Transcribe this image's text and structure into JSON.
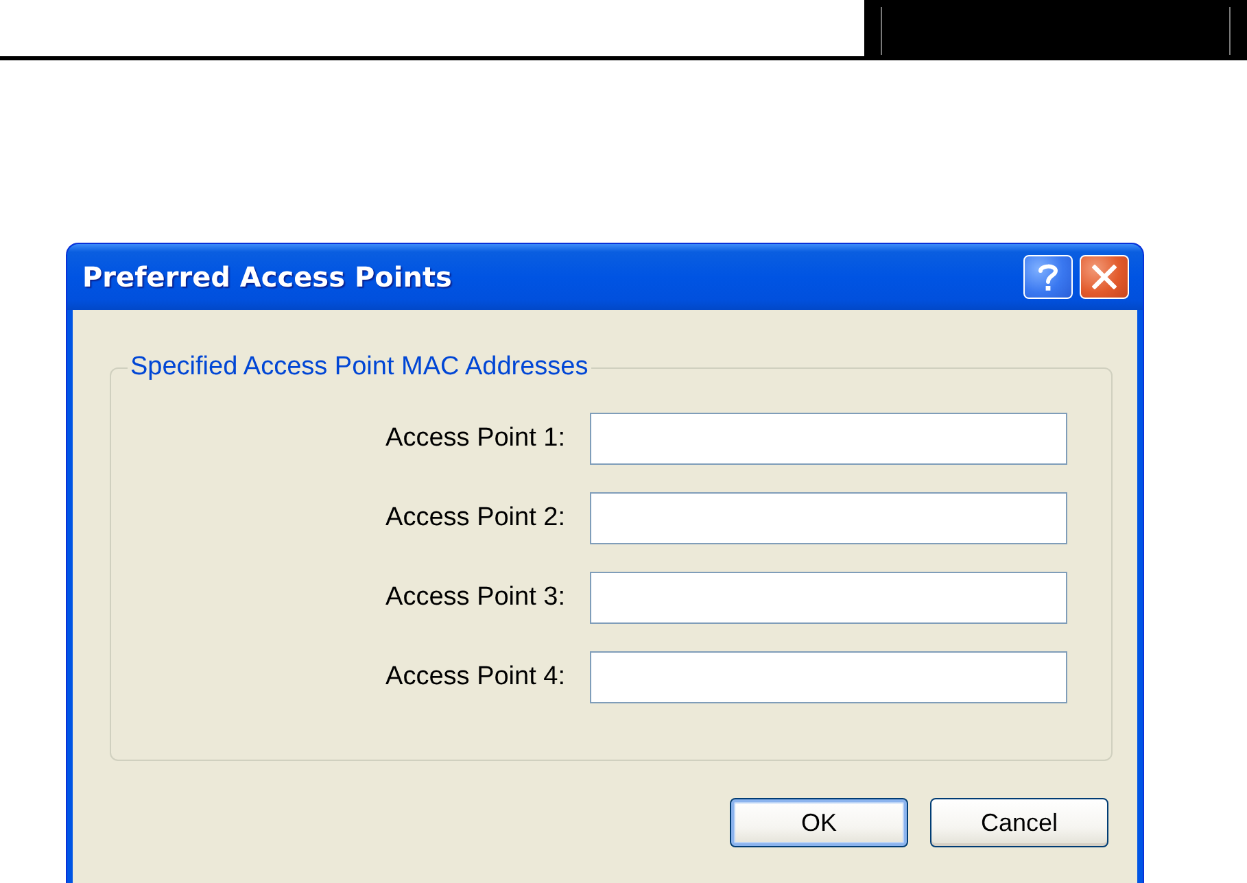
{
  "window": {
    "title": "Preferred Access Points",
    "title_buttons": [
      {
        "kind": "help"
      },
      {
        "kind": "close"
      }
    ]
  },
  "group": {
    "title": "Specified Access Point MAC Addresses",
    "fields": [
      {
        "label": "Access Point 1:"
      },
      {
        "label": "Access Point 2:"
      },
      {
        "label": "Access Point 3:"
      },
      {
        "label": "Access Point 4:"
      }
    ]
  },
  "buttons": [
    {
      "label": "OK",
      "default": true
    },
    {
      "label": "Cancel",
      "default": false
    }
  ]
}
